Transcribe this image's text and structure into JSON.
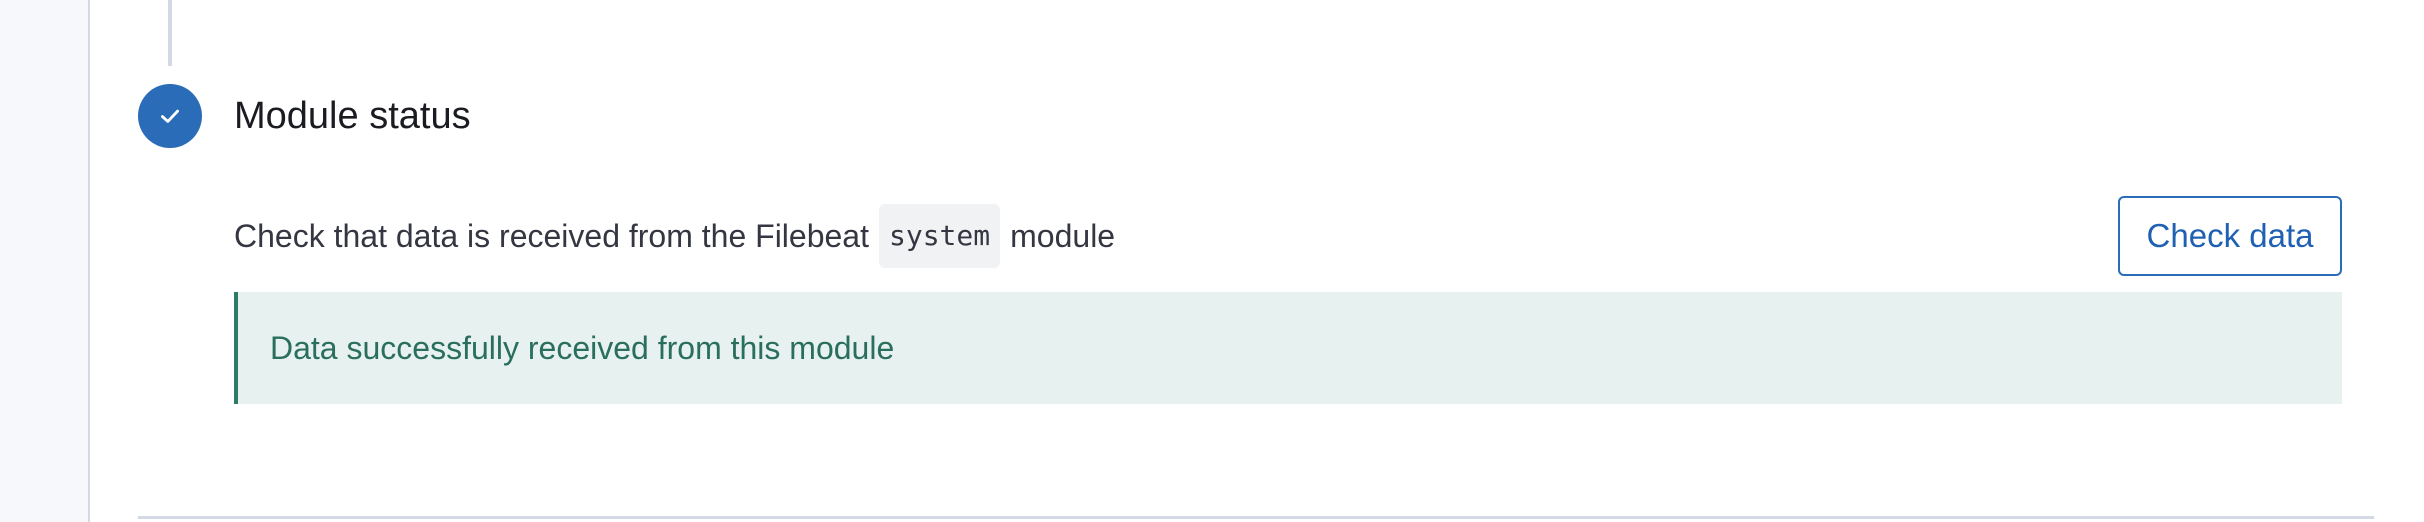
{
  "step": {
    "title": "Module status",
    "status": "complete",
    "badge_icon": "check-icon",
    "badge_color": "#2b6cb8"
  },
  "description": {
    "prefix": "Check that data is received from the Filebeat",
    "code": "system",
    "suffix": "module"
  },
  "actions": {
    "check_data_label": "Check data"
  },
  "callout": {
    "message": "Data successfully received from this module",
    "type": "success",
    "color": "#2d7a67"
  }
}
